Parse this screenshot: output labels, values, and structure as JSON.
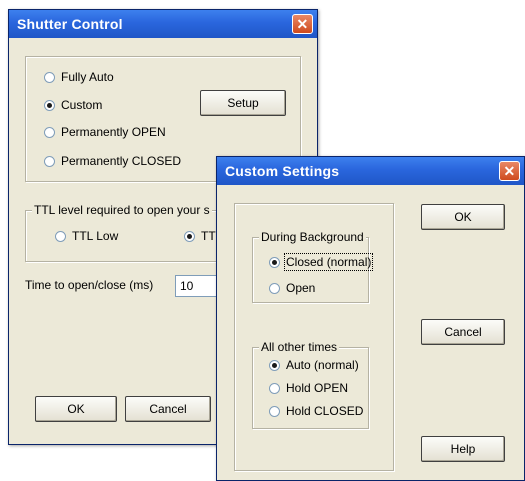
{
  "shutter_control": {
    "title": "Shutter Control",
    "close_glyph": "✕",
    "mode_options": [
      {
        "label": "Fully Auto",
        "checked": false
      },
      {
        "label": "Custom",
        "checked": true
      },
      {
        "label": "Permanently OPEN",
        "checked": false
      },
      {
        "label": "Permanently CLOSED",
        "checked": false
      }
    ],
    "setup_button": "Setup",
    "ttl_group_label": "TTL level required to open your s",
    "ttl_options": [
      {
        "label": "TTL Low",
        "checked": false
      },
      {
        "label": "TT",
        "checked": true
      }
    ],
    "time_label": "Time to open/close (ms)",
    "time_value": "10",
    "ok_button": "OK",
    "cancel_button": "Cancel"
  },
  "custom_settings": {
    "title": "Custom Settings",
    "close_glyph": "✕",
    "background_group_label": "During Background",
    "background_options": [
      {
        "label": "Closed (normal)",
        "checked": true
      },
      {
        "label": "Open",
        "checked": false
      }
    ],
    "other_group_label": "All other times",
    "other_options": [
      {
        "label": "Auto (normal)",
        "checked": true
      },
      {
        "label": "Hold OPEN",
        "checked": false
      },
      {
        "label": "Hold CLOSED",
        "checked": false
      }
    ],
    "ok_button": "OK",
    "cancel_button": "Cancel",
    "help_button": "Help"
  },
  "colors": {
    "titlebar": "#2a66dd",
    "dialog_bg": "#ece9d8",
    "close_button": "#d8582b"
  }
}
